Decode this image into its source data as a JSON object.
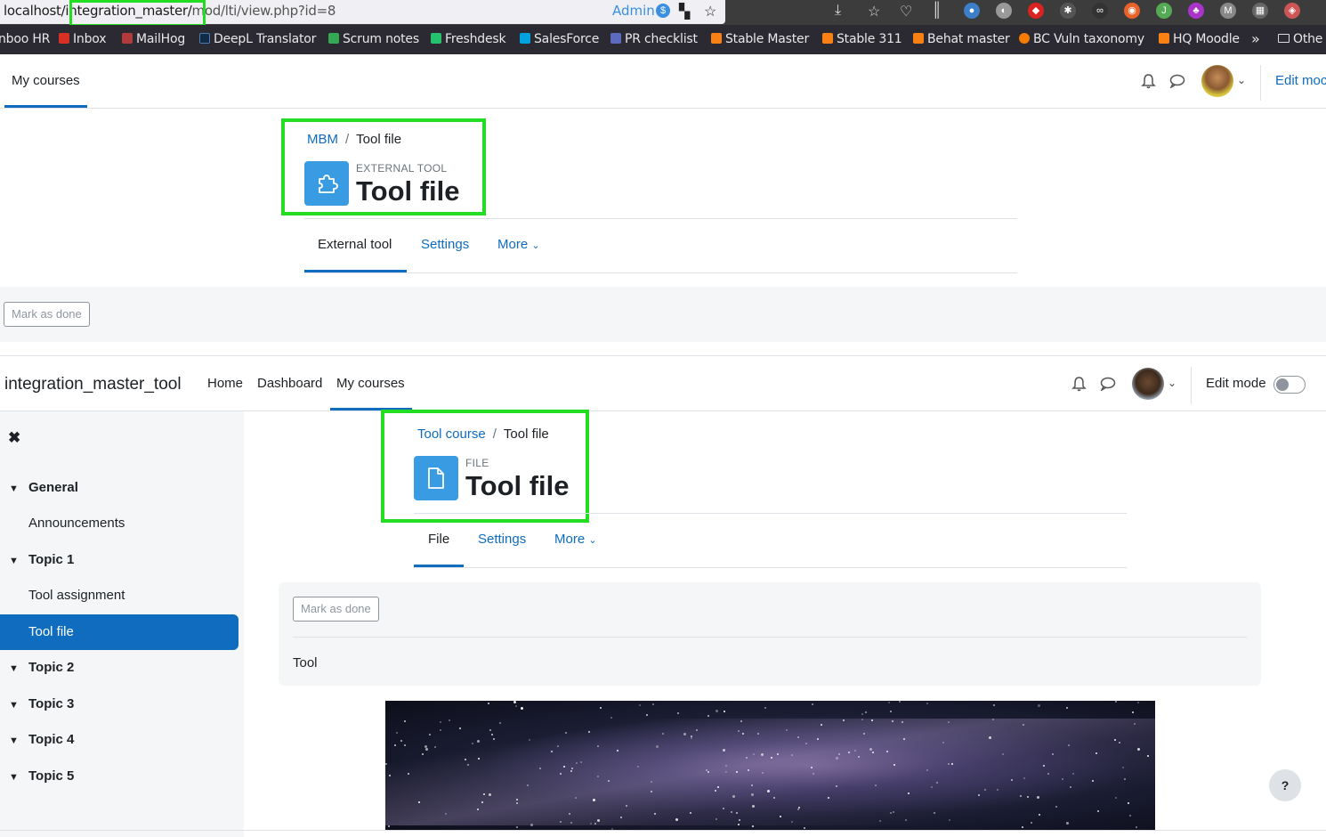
{
  "browser": {
    "url_host": "localhost",
    "url_path_highlight": "/integration_master/",
    "url_rest": "mod/lti/view.php?id=8",
    "profile_label": "Admin",
    "profile_badge": "$",
    "bookmarks": [
      {
        "label": "nboo HR",
        "color": "#888"
      },
      {
        "label": "Inbox",
        "color": "#d93025"
      },
      {
        "label": "MailHog",
        "color": "#b23a3a"
      },
      {
        "label": "DeepL Translator",
        "color": "#0f2b46"
      },
      {
        "label": "Scrum notes",
        "color": "#34a853"
      },
      {
        "label": "Freshdesk",
        "color": "#25c16f"
      },
      {
        "label": "SalesForce",
        "color": "#00a1e0"
      },
      {
        "label": "PR checklist",
        "color": "#5c6bc0"
      },
      {
        "label": "Stable Master",
        "color": "#f98012"
      },
      {
        "label": "Stable 311",
        "color": "#f98012"
      },
      {
        "label": "Behat master",
        "color": "#f98012"
      },
      {
        "label": "BC Vuln taxonomy",
        "color": "#f57c00"
      },
      {
        "label": "HQ Moodle",
        "color": "#f98012"
      }
    ],
    "overflow": "»",
    "other_bookmarks": "Othe"
  },
  "embed": {
    "nav": {
      "my_courses": "My courses",
      "edit_mode": "Edit moc"
    },
    "breadcrumb": {
      "parent": "MBM",
      "current": "Tool file"
    },
    "activity_type": "EXTERNAL TOOL",
    "title": "Tool file",
    "tabs": [
      "External tool",
      "Settings",
      "More"
    ],
    "mark_done": "Mark as done"
  },
  "tool": {
    "site_name": "integration_master_tool",
    "nav": [
      "Home",
      "Dashboard",
      "My courses"
    ],
    "edit_mode": "Edit mode",
    "drawer": {
      "close": "✖",
      "sections": [
        {
          "label": "General",
          "items": [
            "Announcements"
          ]
        },
        {
          "label": "Topic 1",
          "items": [
            "Tool assignment",
            "Tool file"
          ]
        },
        {
          "label": "Topic 2",
          "items": []
        },
        {
          "label": "Topic 3",
          "items": []
        },
        {
          "label": "Topic 4",
          "items": []
        },
        {
          "label": "Topic 5",
          "items": []
        }
      ],
      "active_item": "Tool file"
    },
    "breadcrumb": {
      "parent": "Tool course",
      "current": "Tool file"
    },
    "activity_type": "FILE",
    "title": "Tool file",
    "tabs": [
      "File",
      "Settings",
      "More"
    ],
    "mark_done": "Mark as done",
    "description": "Tool",
    "help": "?"
  },
  "colors": {
    "highlight": "#22dd22",
    "primary": "#0f6cbf",
    "activity_icon": "#399be2"
  }
}
